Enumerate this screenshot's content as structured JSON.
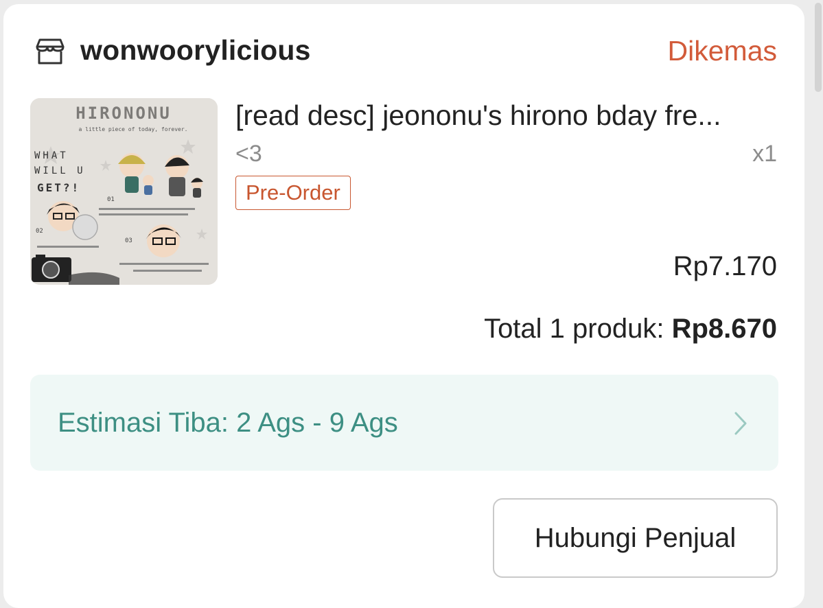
{
  "shop": {
    "name": "wonwoorylicious",
    "status": "Dikemas",
    "icon": "store-icon"
  },
  "product": {
    "title": "[read desc] jeononu's hirono bday fre...",
    "variant": "<3",
    "quantity": "x1",
    "badge": "Pre-Order",
    "price": "Rp7.170",
    "thumbnail": {
      "heading": "HIRONONU",
      "subheading": "a little piece of today, forever.",
      "side_text": [
        "WHAT",
        "WILL U",
        "GET?!"
      ],
      "labels": [
        "01",
        "02",
        "03"
      ]
    }
  },
  "summary": {
    "label": "Total 1 produk:",
    "amount": "Rp8.670"
  },
  "estimate": {
    "label": "Estimasi Tiba: 2 Ags - 9 Ags"
  },
  "actions": {
    "contact_seller": "Hubungi Penjual"
  },
  "colors": {
    "status": "#d25b3a",
    "badge": "#c8562f",
    "estimate_text": "#3d8f83",
    "estimate_bg": "#eff8f6"
  }
}
